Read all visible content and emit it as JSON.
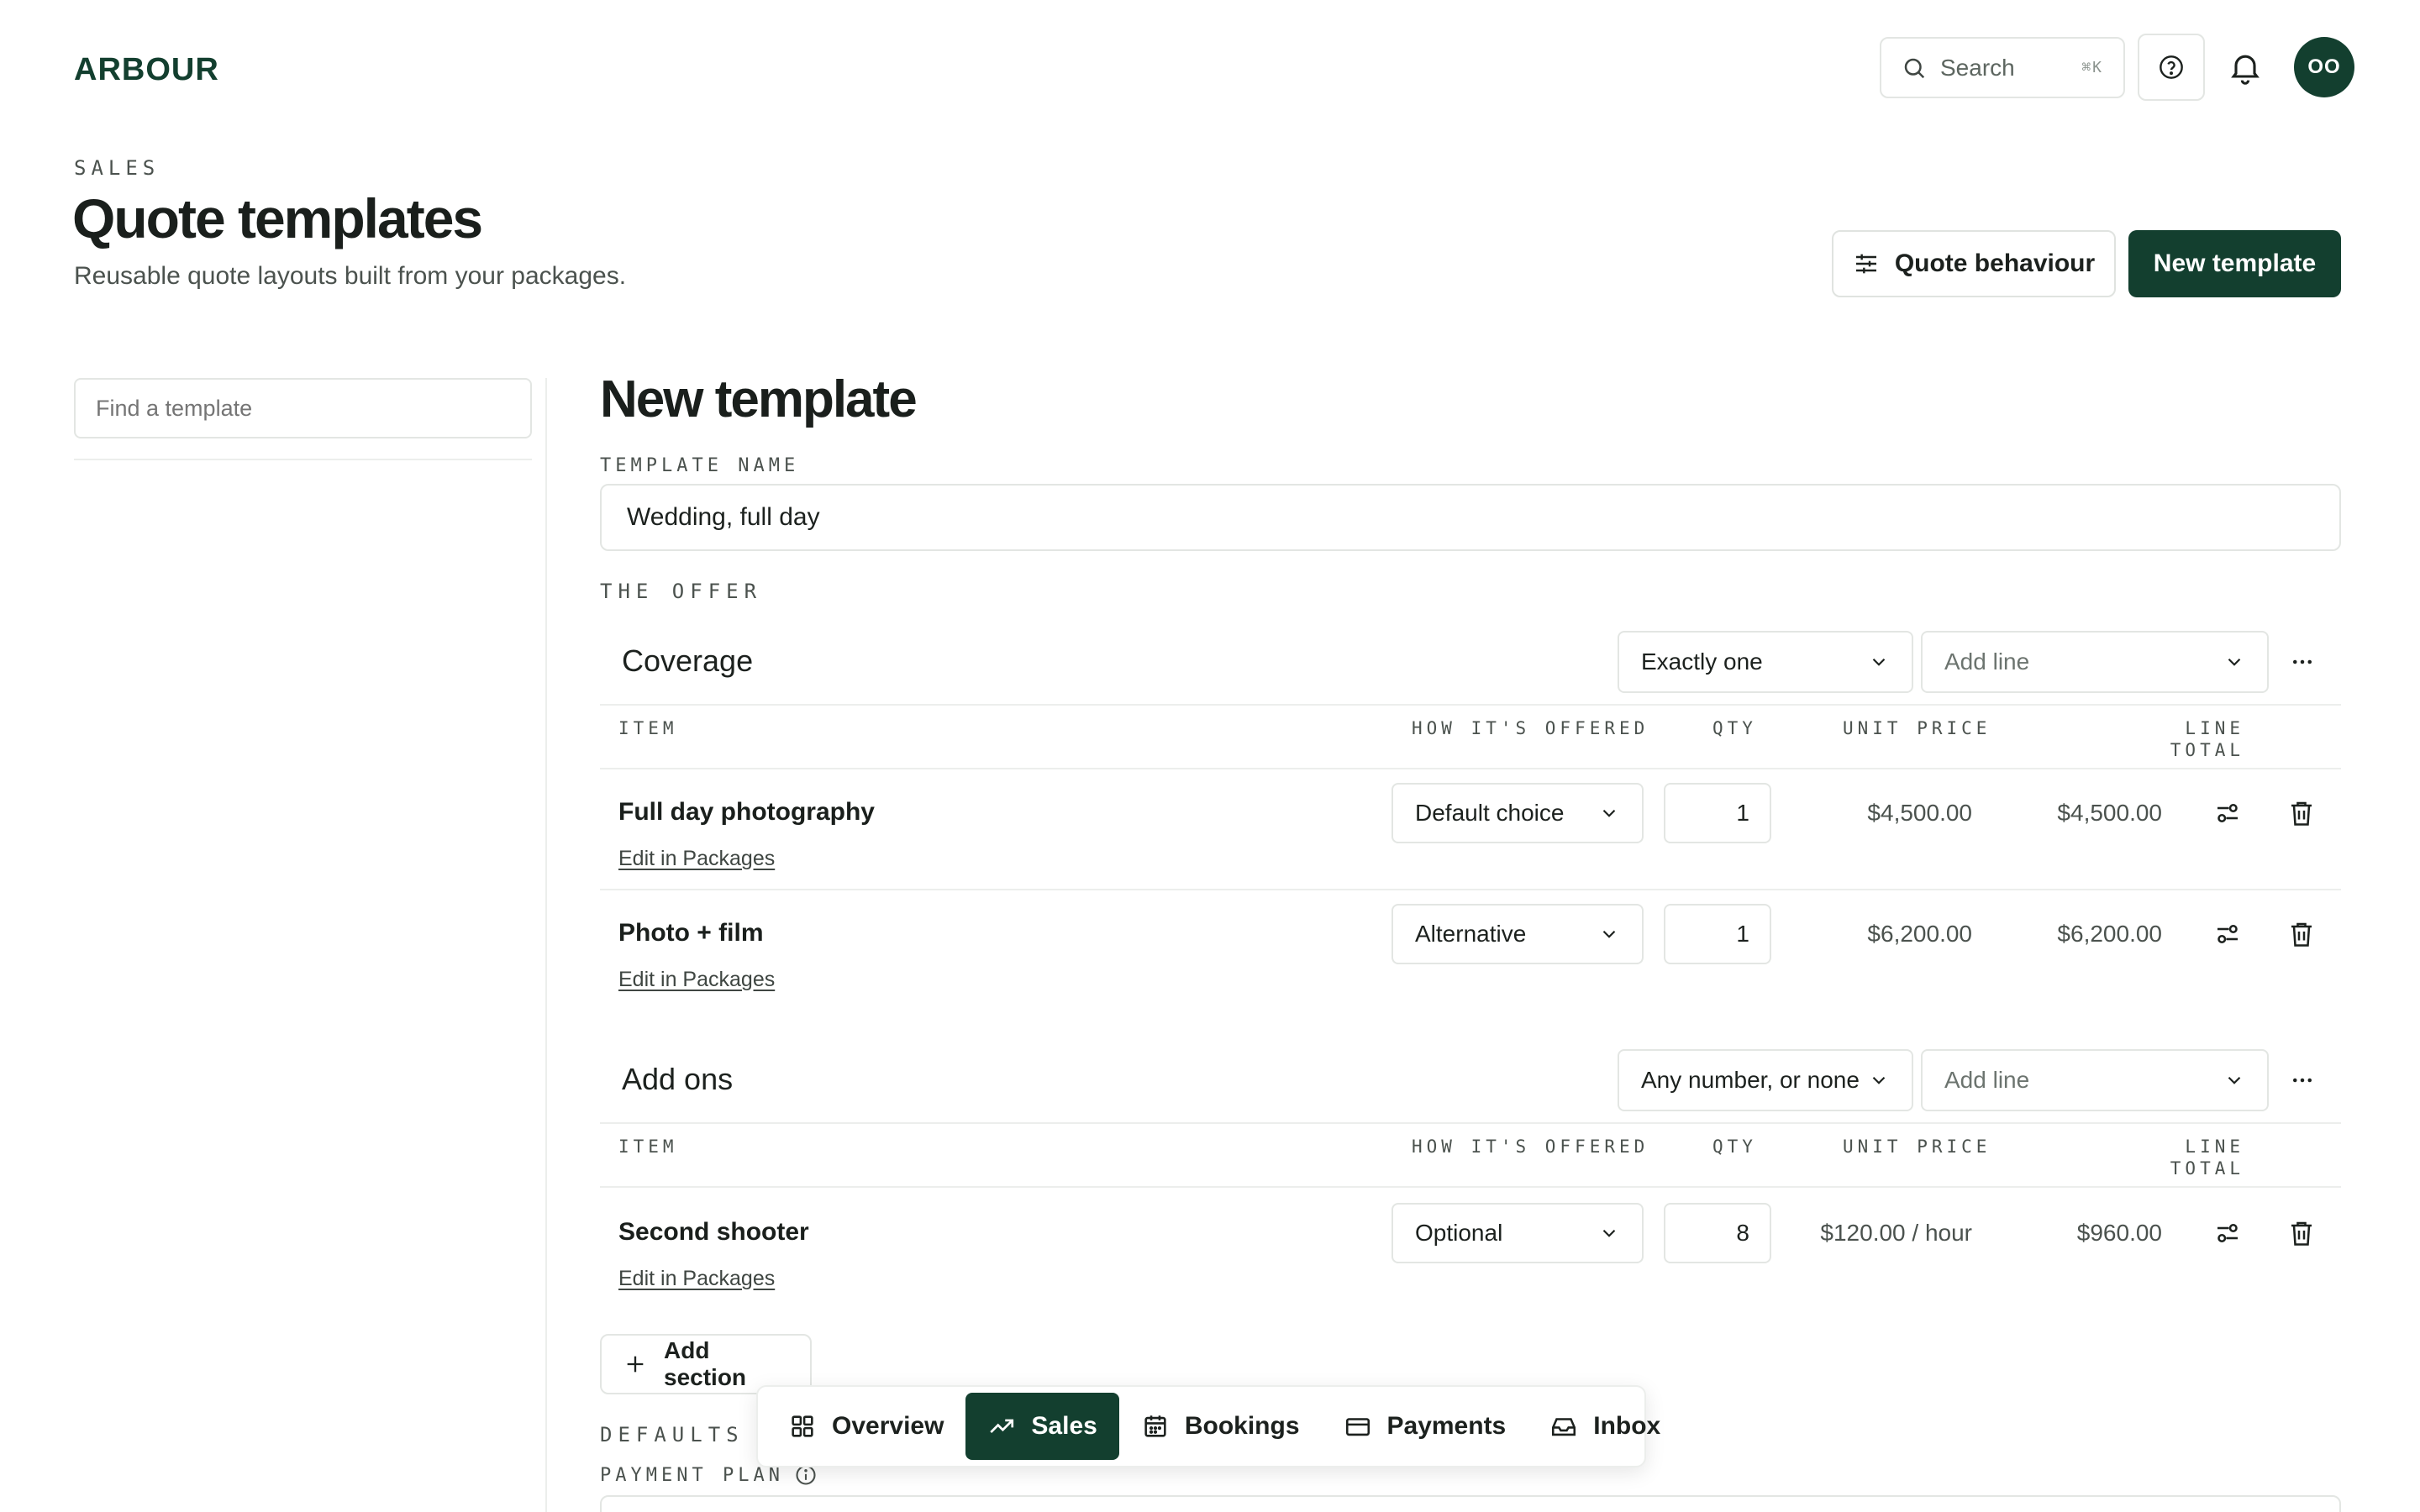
{
  "app": {
    "logo": "ARBOUR",
    "accent": "#133f2f"
  },
  "topbar": {
    "search_label": "Search",
    "search_shortcut": "⌘K",
    "avatar_initials": "OO"
  },
  "header": {
    "eyebrow": "SALES",
    "title": "Quote templates",
    "subtitle": "Reusable quote layouts built from your packages.",
    "quote_behaviour_label": "Quote behaviour",
    "new_template_label": "New template"
  },
  "sidebar": {
    "find_placeholder": "Find a template"
  },
  "editor": {
    "title": "New template",
    "template_name_label": "TEMPLATE NAME",
    "template_name_value": "Wedding, full day",
    "offer_label": "THE OFFER",
    "columns": {
      "item": "ITEM",
      "how": "HOW IT'S OFFERED",
      "qty": "QTY",
      "unit_price": "UNIT PRICE",
      "line_total_1": "LINE",
      "line_total_2": "TOTAL"
    },
    "sections": [
      {
        "title": "Coverage",
        "rule": "Exactly one",
        "add_line_placeholder": "Add line",
        "items": [
          {
            "name": "Full day photography",
            "link": "Edit in Packages",
            "offered": "Default choice",
            "qty": "1",
            "unit_price": "$4,500.00",
            "line_total": "$4,500.00"
          },
          {
            "name": "Photo + film",
            "link": "Edit in Packages",
            "offered": "Alternative",
            "qty": "1",
            "unit_price": "$6,200.00",
            "line_total": "$6,200.00"
          }
        ]
      },
      {
        "title": "Add ons",
        "rule": "Any number, or none",
        "add_line_placeholder": "Add line",
        "items": [
          {
            "name": "Second shooter",
            "link": "Edit in Packages",
            "offered": "Optional",
            "qty": "8",
            "unit_price": "$120.00 / hour",
            "line_total": "$960.00"
          }
        ]
      }
    ],
    "add_section_label": "Add section",
    "defaults_label": "DEFAULTS",
    "payment_plan_label": "PAYMENT PLAN"
  },
  "bottom_nav": {
    "items": [
      {
        "label": "Overview",
        "icon": "grid-icon"
      },
      {
        "label": "Sales",
        "icon": "trend-icon",
        "active": true
      },
      {
        "label": "Bookings",
        "icon": "calendar-icon"
      },
      {
        "label": "Payments",
        "icon": "card-icon"
      },
      {
        "label": "Inbox",
        "icon": "inbox-icon"
      }
    ]
  }
}
